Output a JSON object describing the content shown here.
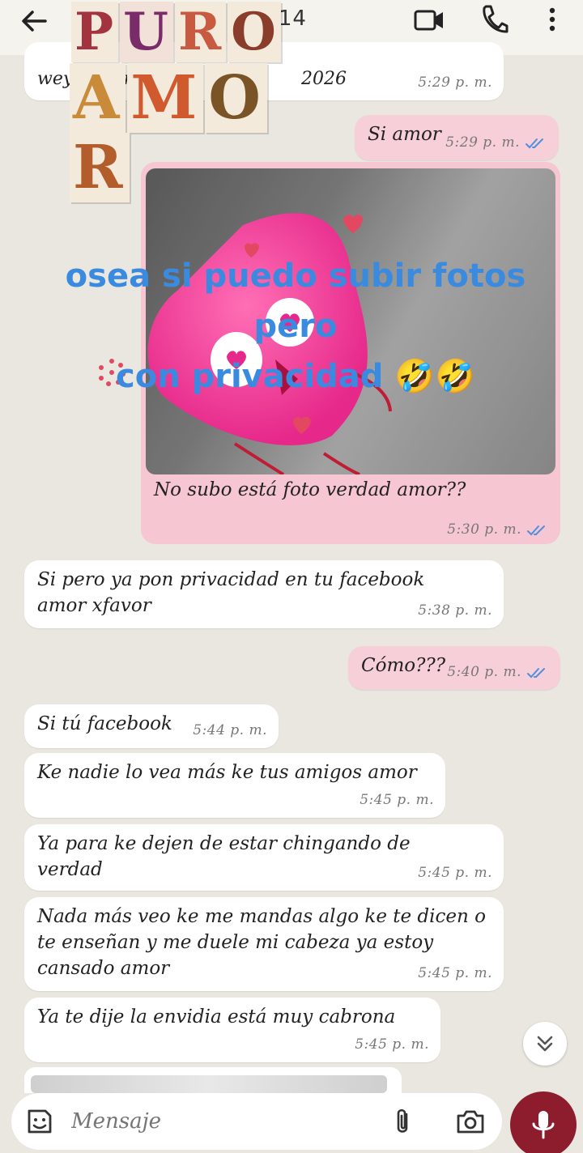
{
  "header": {
    "phone_fragment": "3      1114"
  },
  "sticker": {
    "line1": [
      "P",
      "U",
      "R",
      "O"
    ],
    "line2": [
      "A",
      "M",
      "O",
      "R"
    ]
  },
  "overlay": {
    "line1": "osea si puedo subir  fotos pero",
    "line2": "con privacidad 🤣🤣"
  },
  "messages": [
    {
      "dir": "in",
      "text": "wey       or      2          ab        2026",
      "time": "5:29 p. m."
    },
    {
      "dir": "out",
      "text": "Si amor",
      "time": "5:29 p. m."
    },
    {
      "dir": "out",
      "image": true,
      "caption": "No subo  está foto verdad amor??",
      "time": "5:30 p. m."
    },
    {
      "dir": "in",
      "text": "Si pero ya pon privacidad en tu facebook amor xfavor",
      "time": "5:38 p. m."
    },
    {
      "dir": "out",
      "text": "Cómo???",
      "time": "5:40 p. m."
    },
    {
      "dir": "in",
      "text": "Si tú facebook",
      "time": "5:44 p. m."
    },
    {
      "dir": "in",
      "text": "Ke nadie lo vea más ke tus amigos amor",
      "time": "5:45 p. m."
    },
    {
      "dir": "in",
      "text": "Ya para ke dejen de estar chingando de verdad",
      "time": "5:45 p. m."
    },
    {
      "dir": "in",
      "text": "Nada más veo ke me mandas algo ke te dicen o te enseñan y me duele mi cabeza ya estoy cansado amor",
      "time": "5:45 p. m."
    },
    {
      "dir": "in",
      "text": "Ya te dije la envidia está muy cabrona",
      "time": "5:45 p. m."
    }
  ],
  "composer": {
    "placeholder": "Mensaje"
  },
  "colors": {
    "incoming_bubble": "#ffffff",
    "outgoing_bubble": "#f7cfd8",
    "read_ticks": "#4f8fe0",
    "mic_button": "#8d1c2d",
    "overlay_text": "#3a8be0"
  }
}
